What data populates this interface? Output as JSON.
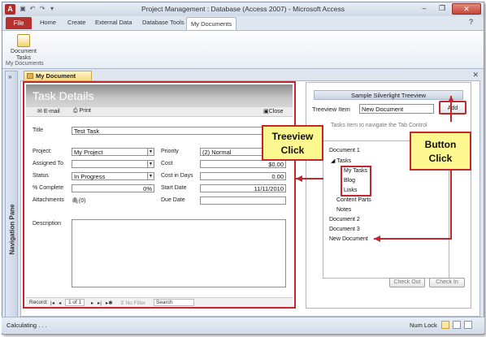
{
  "app": {
    "window_title": "Project Management : Database (Access 2007) - Microsoft Access",
    "icon_letter": "A",
    "win_minimize": "–",
    "win_maximize": "❐",
    "win_close": "✕"
  },
  "ribbon": {
    "file_tab": "File",
    "tabs": [
      "Home",
      "Create",
      "External Data",
      "Database Tools",
      "My Documents"
    ],
    "button_label": "Document Tasks",
    "group_label": "My Documents"
  },
  "nav_pane": {
    "label": "Navigation Pane",
    "toggle": "»"
  },
  "document_tab": {
    "label": "My Document Tasks",
    "close": "✕"
  },
  "form": {
    "header": "Task Details",
    "toolbar": {
      "email": "E-mail",
      "print": "Print",
      "close": "Close"
    },
    "fields": {
      "title_label": "Title",
      "title_value": "Test Task",
      "project_label": "Project:",
      "project_value": "My Project",
      "assigned_label": "Assigned To",
      "assigned_value": "",
      "status_label": "Status",
      "status_value": "In Progress",
      "complete_label": "% Complete",
      "complete_value": "0%",
      "attachments_label": "Attachments",
      "attachments_value": "(0)",
      "priority_label": "Priority",
      "priority_value": "(2) Normal",
      "cost_label": "Cost",
      "cost_value": "$0.00",
      "costdays_label": "Cost in Days",
      "costdays_value": "0.00",
      "start_label": "Start Date",
      "start_value": "11/11/2010",
      "due_label": "Due Date",
      "due_value": "",
      "description_label": "Description"
    },
    "record_bar": {
      "record_label": "Record:",
      "record_value": "1 of 1",
      "filter": "No Filter",
      "search": "Search"
    }
  },
  "treeview_panel": {
    "title": "Sample Silverlight Treeview",
    "item_label": "Treeview Item",
    "item_value": "New Document",
    "add_button": "Add",
    "hint": "Tasks item to navigate the Tab Control",
    "nodes": [
      "Document 1",
      "Tasks",
      "My Tasks",
      "Blog",
      "Links",
      "Content Parts",
      "Notes",
      "Document 2",
      "Document 3",
      "New Document"
    ],
    "checkout_button": "Check Out",
    "checkin_button": "Check In"
  },
  "callouts": {
    "treeview_line1": "Treeview",
    "treeview_line2": "Click",
    "button_line1": "Button",
    "button_line2": "Click"
  },
  "status_bar": {
    "left": "Calculating . . .",
    "num_lock": "Num Lock"
  },
  "colors": {
    "accent_red": "#c0282d",
    "callout_yellow": "#fdf78f",
    "file_tab": "#b5322e"
  }
}
